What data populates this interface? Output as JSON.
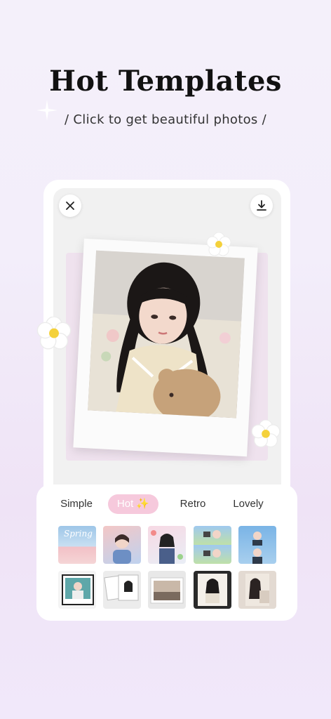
{
  "header": {
    "title": "Hot Templates",
    "subtitle": "/ Click to get beautiful photos /"
  },
  "preview": {
    "close_icon": "close-icon",
    "download_icon": "download-icon"
  },
  "tabs": [
    {
      "label": "Simple"
    },
    {
      "label": "Hot ✨"
    },
    {
      "label": "Retro"
    },
    {
      "label": "Lovely"
    }
  ],
  "thumbnails": {
    "row1": [
      {
        "caption": "Spring"
      },
      {
        "caption": ""
      },
      {
        "caption": ""
      },
      {
        "caption": ""
      },
      {
        "caption": ""
      }
    ]
  },
  "colors": {
    "active_tab": "#f6c9dc",
    "flower_center": "#f4d13b"
  }
}
